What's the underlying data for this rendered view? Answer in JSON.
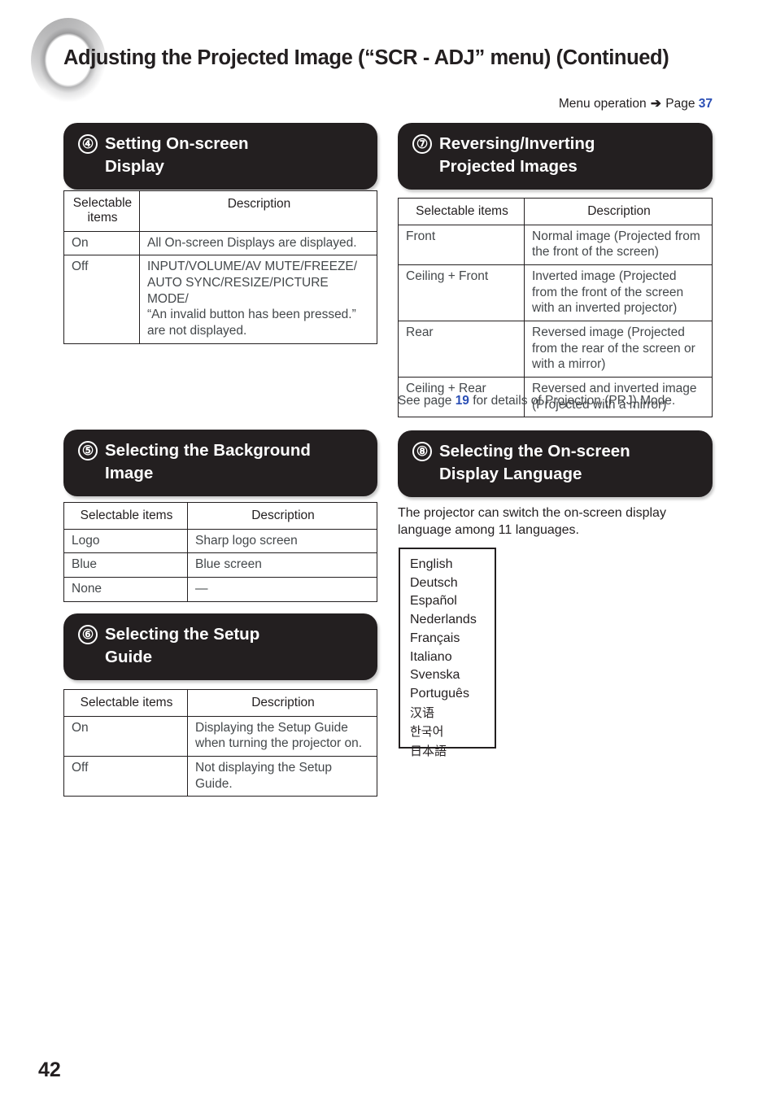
{
  "page": {
    "title": "Adjusting the Projected Image (“SCR - ADJ” menu) (Continued)",
    "number": "42",
    "accent_blue": "#2b4fb5",
    "ink": "#231f20"
  },
  "menu_operation": {
    "label": "Menu operation",
    "arrow": "➔",
    "page_word": "Page",
    "page_ref": "37"
  },
  "sections": [
    {
      "number": "④",
      "title_line1": "Setting On-screen",
      "title_line2": "Display",
      "table": {
        "headers": [
          "Selectable items",
          "Description"
        ],
        "rows": [
          [
            "On",
            "All On-screen Displays are displayed."
          ],
          [
            "Off",
            "INPUT/VOLUME/AV MUTE/FREEZE/\nAUTO SYNC/RESIZE/PICTURE MODE/\n“An invalid button has been pressed.”\nare not displayed."
          ]
        ]
      }
    },
    {
      "number": "⑤",
      "title_line1": "Selecting the Background",
      "title_line2": "Image",
      "table": {
        "headers": [
          "Selectable items",
          "Description"
        ],
        "rows": [
          [
            "Logo",
            "Sharp logo screen"
          ],
          [
            "Blue",
            "Blue screen"
          ],
          [
            "None",
            "—"
          ]
        ]
      }
    },
    {
      "number": "⑥",
      "title_line1": "Selecting the Setup",
      "title_line2": "Guide",
      "table": {
        "headers": [
          "Selectable items",
          "Description"
        ],
        "rows": [
          [
            "On",
            "Displaying the Setup Guide\nwhen turning the projector on."
          ],
          [
            "Off",
            "Not displaying the Setup\nGuide."
          ]
        ]
      }
    },
    {
      "number": "⑦",
      "title_line1": "Reversing/Inverting",
      "title_line2": "Projected Images",
      "table": {
        "headers": [
          "Selectable items",
          "Description"
        ],
        "rows": [
          [
            "Front",
            "Normal image (Projected from\nthe front of the screen)"
          ],
          [
            "Ceiling + Front",
            "Inverted image (Projected\nfrom the front of the screen\nwith an inverted projector)"
          ],
          [
            "Rear",
            "Reversed image (Projected\nfrom the rear of the screen or\nwith a mirror)"
          ],
          [
            "Ceiling + Rear",
            "Reversed and inverted image\n(Projected with a mirror)"
          ]
        ]
      },
      "footnote": {
        "prefix": "See page ",
        "ref": "19",
        "suffix": " for details of Projection (PRJ) Mode."
      }
    },
    {
      "number": "⑧",
      "title_line1": "Selecting the On-screen",
      "title_line2": "Display Language",
      "paragraph": "The projector can switch the on-screen display\nlanguage among 11 languages.",
      "languages": [
        "English",
        "Deutsch",
        "Español",
        "Nederlands",
        "Français",
        "Italiano",
        "Svenska",
        "Português",
        "汉语",
        "한국어",
        "日本語"
      ]
    }
  ]
}
